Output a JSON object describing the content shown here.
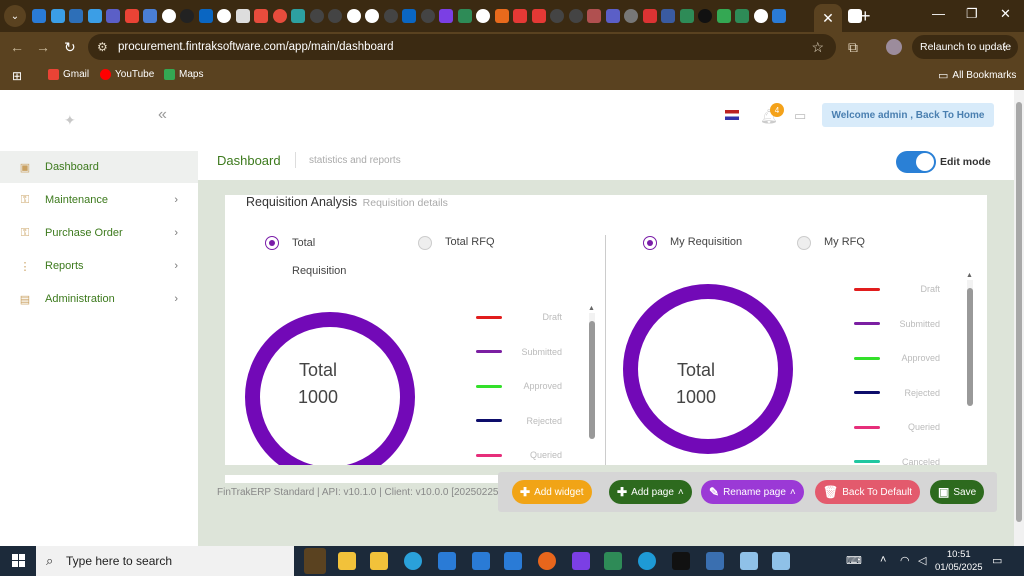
{
  "browser": {
    "url": "procurement.fintraksoftware.com/app/main/dashboard",
    "relaunch_label": "Relaunch to update",
    "bookmarks": [
      {
        "label": "Gmail",
        "icon": "gmail-icon"
      },
      {
        "label": "YouTube",
        "icon": "youtube-icon"
      },
      {
        "label": "Maps",
        "icon": "maps-icon"
      }
    ],
    "all_bookmarks_label": "All Bookmarks"
  },
  "sidebar": {
    "items": [
      {
        "label": "Dashboard",
        "icon": "dashboard-icon",
        "active": true
      },
      {
        "label": "Maintenance",
        "icon": "wrench-icon"
      },
      {
        "label": "Purchase Order",
        "icon": "cart-icon"
      },
      {
        "label": "Reports",
        "icon": "kebab-icon"
      },
      {
        "label": "Administration",
        "icon": "admin-icon"
      }
    ]
  },
  "topbar": {
    "notification_count": "4",
    "welcome_label": "Welcome admin , Back To Home"
  },
  "page": {
    "title": "Dashboard",
    "subtitle": "statistics and reports",
    "edit_mode_label": "Edit mode",
    "edit_mode_on": true
  },
  "widget": {
    "title": "Requisition Analysis",
    "subtitle": "Requisition details",
    "left": {
      "radio_a": "Total",
      "radio_a_line2": "Requisition",
      "radio_b": "Total RFQ",
      "center_label": "Total",
      "center_value": "1000",
      "legend": [
        {
          "label": "Draft",
          "color": "#e11d1d"
        },
        {
          "label": "Submitted",
          "color": "#7b1fa2"
        },
        {
          "label": "Approved",
          "color": "#33e02a"
        },
        {
          "label": "Rejected",
          "color": "#0d0d6b"
        },
        {
          "label": "Queried",
          "color": "#e62e7a"
        }
      ]
    },
    "right": {
      "radio_a": "My Requisition",
      "radio_b": "My RFQ",
      "center_label": "Total",
      "center_value": "1000",
      "legend": [
        {
          "label": "Draft",
          "color": "#e11d1d"
        },
        {
          "label": "Submitted",
          "color": "#7b1fa2"
        },
        {
          "label": "Approved",
          "color": "#33e02a"
        },
        {
          "label": "Rejected",
          "color": "#0d0d6b"
        },
        {
          "label": "Queried",
          "color": "#e62e7a"
        },
        {
          "label": "Canceled",
          "color": "#1fc7a0"
        }
      ]
    },
    "donut_color": "#7209b7"
  },
  "footer": {
    "text": "FinTrakERP Standard | API: v10.1.0 | Client: v10.0.0 [20250225]"
  },
  "actions": {
    "add_widget": "Add widget",
    "add_page": "Add page",
    "rename_page": "Rename page",
    "back_default": "Back To Default",
    "save": "Save"
  },
  "taskbar": {
    "search_placeholder": "Type here to search",
    "time": "10:51",
    "date": "01/05/2025"
  }
}
